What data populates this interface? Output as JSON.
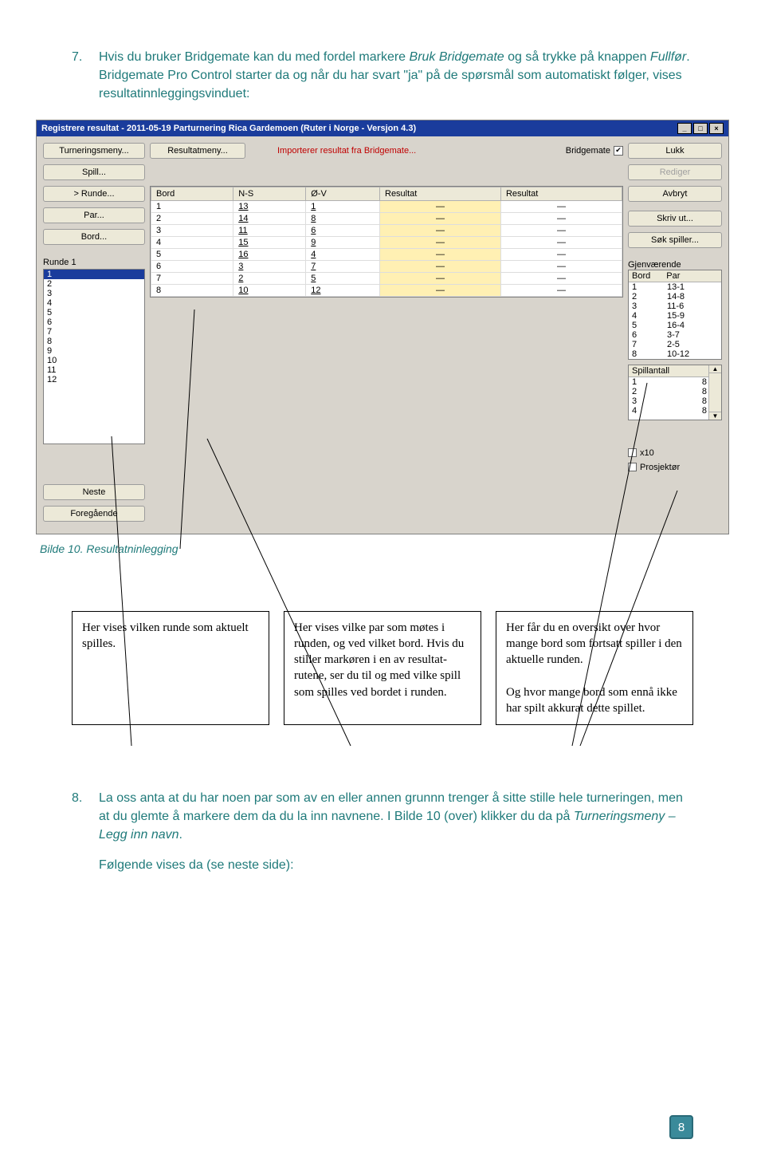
{
  "item7": {
    "num": "7.",
    "text_a": "Hvis du bruker Bridgemate kan du med fordel markere ",
    "italic_a": "Bruk Bridgemate",
    "text_b": " og så trykke på knappen ",
    "italic_b": "Fullfør",
    "text_c": ". Bridgemate Pro Control starter da og når du har svart \"ja\" på de spørsmål som automatiskt følger, vises resultatinnleggingsvinduet:"
  },
  "window": {
    "title": "Registrere resultat - 2011-05-19  Parturnering Rica Gardemoen  (Ruter i Norge - Versjon 4.3)",
    "left_buttons": [
      "Turneringsmeny...",
      "Spill...",
      ">    Runde...",
      "Par...",
      "Bord..."
    ],
    "mid_top": {
      "resultat": "Resultatmeny...",
      "import": "Importerer resultat fra Bridgemate...",
      "bmate": "Bridgemate"
    },
    "right_buttons": [
      "Lukk",
      "Avbryt",
      "Skriv ut...",
      "Søk spiller..."
    ],
    "rediger": "Rediger",
    "table": {
      "headers": [
        "Bord",
        "N-S",
        "Ø-V",
        "Resultat",
        "Resultat"
      ],
      "rows": [
        [
          "1",
          "13",
          "1",
          "—",
          "—"
        ],
        [
          "2",
          "14",
          "8",
          "—",
          "—"
        ],
        [
          "3",
          "11",
          "6",
          "—",
          "—"
        ],
        [
          "4",
          "15",
          "9",
          "—",
          "—"
        ],
        [
          "5",
          "16",
          "4",
          "—",
          "—"
        ],
        [
          "6",
          "3",
          "7",
          "—",
          "—"
        ],
        [
          "7",
          "2",
          "5",
          "—",
          "—"
        ],
        [
          "8",
          "10",
          "12",
          "—",
          "—"
        ]
      ]
    },
    "runde_label": "Runde 1",
    "rundelist": [
      "1",
      "2",
      "3",
      "4",
      "5",
      "6",
      "7",
      "8",
      "9",
      "10",
      "11",
      "12"
    ],
    "gjen": {
      "title": "Gjenværende",
      "headers": [
        "Bord",
        "Par"
      ],
      "rows": [
        [
          "1",
          "13-1"
        ],
        [
          "2",
          "14-8"
        ],
        [
          "3",
          "11-6"
        ],
        [
          "4",
          "15-9"
        ],
        [
          "5",
          "16-4"
        ],
        [
          "6",
          "3-7"
        ],
        [
          "7",
          "2-5"
        ],
        [
          "8",
          "10-12"
        ]
      ]
    },
    "spillantall": {
      "title": "Spillantall",
      "rows": [
        [
          "1",
          "8"
        ],
        [
          "2",
          "8"
        ],
        [
          "3",
          "8"
        ],
        [
          "4",
          "8"
        ]
      ]
    },
    "x10": "x10",
    "prosj": "Prosjektør",
    "neste": "Neste",
    "foreg": "Foregående"
  },
  "caption": "Bilde 10. Resultatninlegging",
  "callouts": {
    "c1": "Her vises vilken runde som aktuelt spilles.",
    "c2": "Her vises vilke par som møtes i runden, og ved vilket bord. Hvis du stiller markøren i en av resultat-rutene, ser du til og med vilke spill som spilles ved bordet i runden.",
    "c3a": "Her får du en oversikt over hvor mange bord som fortsatt spiller i den aktuelle runden.",
    "c3b": "Og hvor mange bord som ennå ikke har spilt akkurat dette spillet."
  },
  "item8": {
    "num": "8.",
    "text_a": "La oss anta at du har noen par som av en eller annen grunnn trenger å sitte stille hele turneringen, men at du glemte å markere dem da du la inn navnene. I Bilde 10 (over) klikker du da på ",
    "italic_a": "Turneringsmeny – Legg inn navn",
    "text_b": ".",
    "follow": "Følgende vises da (se neste side):"
  },
  "page": "8"
}
